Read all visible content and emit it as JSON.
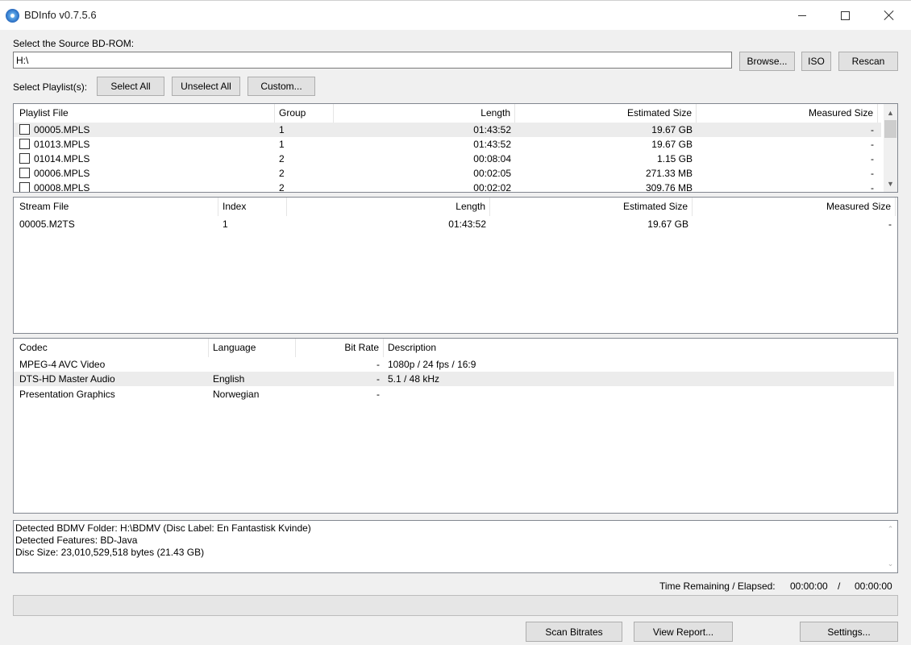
{
  "window": {
    "title": "BDInfo v0.7.5.6",
    "minimize_icon": "minimize-icon",
    "maximize_icon": "maximize-icon",
    "close_icon": "close-icon"
  },
  "source": {
    "label": "Select the Source BD-ROM:",
    "path": "H:\\",
    "browse_label": "Browse...",
    "iso_label": "ISO",
    "rescan_label": "Rescan"
  },
  "playlist_controls": {
    "label": "Select Playlist(s):",
    "select_all_label": "Select All",
    "unselect_all_label": "Unselect All",
    "custom_label": "Custom..."
  },
  "playlists": {
    "columns": [
      "Playlist File",
      "Group",
      "Length",
      "Estimated Size",
      "Measured Size"
    ],
    "rows": [
      {
        "file": "00005.MPLS",
        "group": "1",
        "length": "01:43:52",
        "estimated": "19.67 GB",
        "measured": "-",
        "checked": false,
        "highlighted": true
      },
      {
        "file": "01013.MPLS",
        "group": "1",
        "length": "01:43:52",
        "estimated": "19.67 GB",
        "measured": "-",
        "checked": false,
        "highlighted": false
      },
      {
        "file": "01014.MPLS",
        "group": "2",
        "length": "00:08:04",
        "estimated": "1.15 GB",
        "measured": "-",
        "checked": false,
        "highlighted": false
      },
      {
        "file": "00006.MPLS",
        "group": "2",
        "length": "00:02:05",
        "estimated": "271.33 MB",
        "measured": "-",
        "checked": false,
        "highlighted": false
      },
      {
        "file": "00008.MPLS",
        "group": "2",
        "length": "00:02:02",
        "estimated": "309.76 MB",
        "measured": "-",
        "checked": false,
        "highlighted": false
      }
    ]
  },
  "streams": {
    "columns": [
      "Stream File",
      "Index",
      "Length",
      "Estimated Size",
      "Measured Size"
    ],
    "rows": [
      {
        "file": "00005.M2TS",
        "index": "1",
        "length": "01:43:52",
        "estimated": "19.67 GB",
        "measured": "-"
      }
    ]
  },
  "codecs": {
    "columns": [
      "Codec",
      "Language",
      "Bit Rate",
      "Description"
    ],
    "rows": [
      {
        "codec": "MPEG-4 AVC Video",
        "language": "",
        "bitrate": "-",
        "description": "1080p / 24 fps / 16:9",
        "highlighted": false
      },
      {
        "codec": "DTS-HD Master Audio",
        "language": "English",
        "bitrate": "-",
        "description": "5.1 / 48 kHz",
        "highlighted": true
      },
      {
        "codec": "Presentation Graphics",
        "language": "Norwegian",
        "bitrate": "-",
        "description": "",
        "highlighted": false
      }
    ]
  },
  "log": {
    "lines": [
      "Detected BDMV Folder: H:\\BDMV (Disc Label: En Fantastisk Kvinde)",
      "Detected Features: BD-Java",
      "Disc Size: 23,010,529,518 bytes (21.43 GB)"
    ]
  },
  "status": {
    "time_label": "Time Remaining / Elapsed:",
    "remaining": "00:00:00",
    "separator": "/",
    "elapsed": "00:00:00",
    "progress_fraction": 0
  },
  "footer": {
    "scan_label": "Scan Bitrates",
    "report_label": "View Report...",
    "settings_label": "Settings..."
  }
}
